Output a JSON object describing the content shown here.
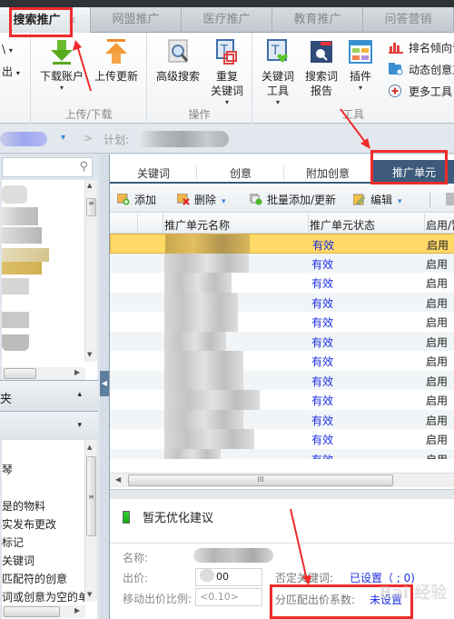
{
  "top_tabs": [
    {
      "label": "搜索推广",
      "active": true,
      "close": "×"
    },
    {
      "label": "网盟推广",
      "active": false
    },
    {
      "label": "医疗推广",
      "active": false
    },
    {
      "label": "教育推广",
      "active": false
    },
    {
      "label": "问答营销",
      "active": false
    }
  ],
  "ribbon": {
    "partial_left": [
      {
        "label": "\\",
        "caret": "▾"
      },
      {
        "label": "出",
        "caret": "▾"
      }
    ],
    "groups": [
      {
        "label": "上传/下载",
        "buttons": [
          {
            "label": "下载账户",
            "caret": "▾",
            "icon": "download-arrow-icon"
          },
          {
            "label": "上传更新",
            "icon": "upload-arrow-icon"
          }
        ]
      },
      {
        "label": "操作",
        "buttons": [
          {
            "label": "高级搜索",
            "icon": "advanced-search-icon"
          },
          {
            "label_line1": "重复",
            "label_line2": "关键词",
            "caret": "▾",
            "icon": "duplicate-keyword-icon"
          }
        ]
      },
      {
        "label": "工具",
        "buttons": [
          {
            "label_line1": "关键词",
            "label_line2": "工具",
            "caret": "▾",
            "icon": "keyword-tool-icon"
          },
          {
            "label_line1": "搜索词",
            "label_line2": "报告",
            "icon": "search-term-report-icon"
          },
          {
            "label": "插件",
            "caret": "▾",
            "icon": "plugin-icon"
          }
        ],
        "small_buttons": [
          {
            "label": "排名倾向调",
            "icon": "ranking-chart-icon"
          },
          {
            "label": "动态创意工",
            "icon": "dynamic-creative-icon"
          },
          {
            "label": "更多工具",
            "icon": "more-tools-plus-icon"
          }
        ]
      }
    ]
  },
  "breadcrumb": {
    "separator": ">",
    "plan_label": "计划:",
    "dropdown": "▾"
  },
  "left_panel": {
    "search_icon": "⚲",
    "section1_label": "夹",
    "section1_caret": "▴",
    "section2_caret": "▾",
    "tree_items": [
      "琴",
      "是的物料",
      "实发布更改",
      "标记",
      "关键词",
      "匹配符的创意",
      "词或创意为空的单元"
    ]
  },
  "sub_tabs": [
    {
      "label": "关键词",
      "active": false
    },
    {
      "label": "创意",
      "active": false
    },
    {
      "label": "附加创意",
      "active": false
    },
    {
      "label": "推广单元",
      "active": true
    }
  ],
  "toolbar": {
    "add_label": "添加",
    "delete_label": "删除",
    "batch_label": "批量添加/更新",
    "edit_label": "编辑",
    "caret": "▾"
  },
  "grid": {
    "columns": [
      "推广单元名称",
      "推广单元状态",
      "启用/暂"
    ],
    "rows": [
      {
        "status": "有效",
        "enabled": "启用",
        "selected": true
      },
      {
        "status": "有效",
        "enabled": "启用"
      },
      {
        "status": "有效",
        "enabled": "启用"
      },
      {
        "status": "有效",
        "enabled": "启用"
      },
      {
        "status": "有效",
        "enabled": "启用"
      },
      {
        "status": "有效",
        "enabled": "启用"
      },
      {
        "status": "有效",
        "enabled": "启用"
      },
      {
        "status": "有效",
        "enabled": "启用"
      },
      {
        "status": "有效",
        "enabled": "启用"
      },
      {
        "status": "有效",
        "enabled": "启用"
      },
      {
        "status": "有效",
        "enabled": "启用"
      },
      {
        "status": "有效",
        "enabled": "启用"
      }
    ],
    "hscroll_grip": "III"
  },
  "detail": {
    "suggestion": "暂无优化建议",
    "name_label": "名称:",
    "bid_label": "出价:",
    "bid_value": "00",
    "mobile_ratio_label": "移动出价比例:",
    "mobile_ratio_placeholder": "<0.10>",
    "negative_kw_label": "否定关键词:",
    "negative_kw_value": "已设置（    ; 0)",
    "match_bid_label": "分匹配出价系数:",
    "match_bid_value": "未设置"
  },
  "watermark": "Bai 经验",
  "colors": {
    "accent_tab": "#3d5a7c",
    "link_blue": "#1a2fe0",
    "selected_row": "#ffd866",
    "annotation_red": "#ef2b2b"
  }
}
